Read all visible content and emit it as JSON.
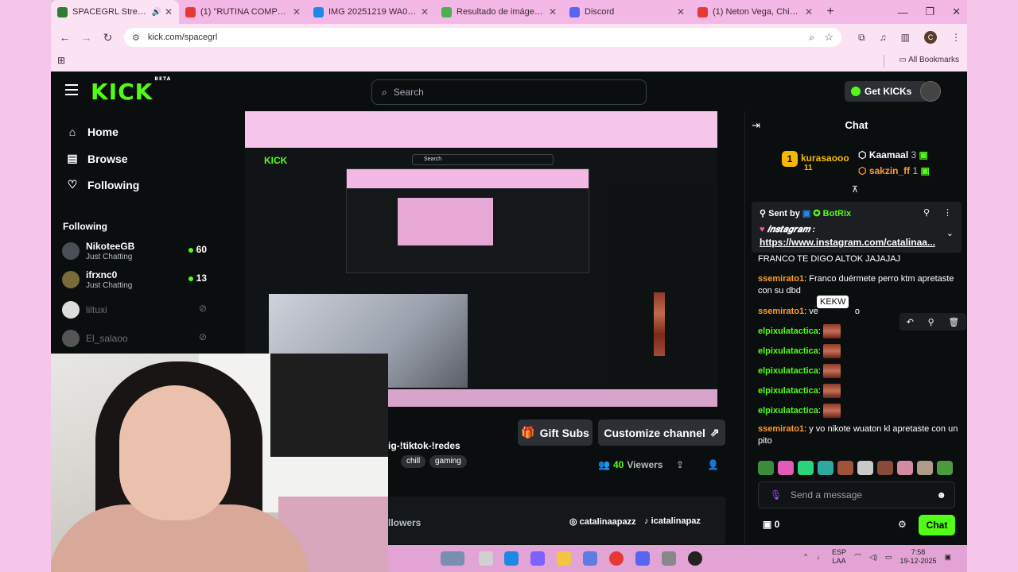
{
  "browser": {
    "tabs": [
      {
        "title": "SPACEGRL Stream - Watch",
        "color": "#2e7d32"
      },
      {
        "title": "(1) \"RUTINA COMPLETA\"",
        "color": "#e53935"
      },
      {
        "title": "IMG 20251219 WA0016 ho",
        "color": "#1e88e5"
      },
      {
        "title": "Resultado de imágenes de",
        "color": "#4caf50"
      },
      {
        "title": "Discord",
        "color": "#5865f2"
      },
      {
        "title": "(1) Neton Vega, Chino Pac",
        "color": "#e53935"
      }
    ],
    "new_tab": "+",
    "url": "kick.com/spacegrl",
    "bookmarks_label": "All Bookmarks",
    "profile_initial": "C"
  },
  "kick": {
    "logo": "KICK",
    "beta": "BETA",
    "search_placeholder": "Search",
    "get_kicks": "Get KICKs"
  },
  "sidebar": {
    "nav": [
      "Home",
      "Browse",
      "Following"
    ],
    "following_title": "Following",
    "following": [
      {
        "name": "NikoteeGB",
        "category": "Just Chatting",
        "viewers": "60",
        "live": true
      },
      {
        "name": "ifrxnc0",
        "category": "Just Chatting",
        "viewers": "13",
        "live": true
      },
      {
        "name": "liltuxi",
        "category": "",
        "viewers": "",
        "live": false
      },
      {
        "name": "El_salaoo",
        "category": "",
        "viewers": "",
        "live": false
      }
    ]
  },
  "stream": {
    "tagline": "ig-!tiktok-!redes",
    "tags": [
      "chill",
      "gaming"
    ],
    "gift_subs": "Gift Subs",
    "customize": "Customize channel",
    "viewers_count": "40",
    "viewers_label": "Viewers",
    "followers_label": "llowers",
    "instagram": "catalinaapazz",
    "tiktok": "icatalinapaz"
  },
  "chat": {
    "title": "Chat",
    "leaders": [
      {
        "name": "kurasaooo",
        "count": "11"
      },
      {
        "name": "Kaamaal",
        "count": "3"
      },
      {
        "name": "sakzin_ff",
        "count": "1"
      }
    ],
    "pinned": {
      "sent_by": "Sent by",
      "bot": "BotRix",
      "ig_label": "𝒊𝒏𝒔𝒕𝒂𝒈𝒓𝒂𝒎 :",
      "link": "https://www.instagram.com/catalinaa..."
    },
    "messages": [
      {
        "user": "",
        "text": "FRANCO TE DIGO ALTOK JAJAJAJ"
      },
      {
        "user": "ssemirato1",
        "text": "Franco duérmete perro ktm apretaste con su dbd"
      },
      {
        "user": "ssemirato1",
        "text": "ve"
      },
      {
        "user": "elpixulatactica",
        "text": ""
      },
      {
        "user": "elpixulatactica",
        "text": ""
      },
      {
        "user": "elpixulatactica",
        "text": ""
      },
      {
        "user": "elpixulatactica",
        "text": ""
      },
      {
        "user": "elpixulatactica",
        "text": ""
      },
      {
        "user": "ssemirato1",
        "text": "y vo nikote wuaton kl apretaste con un pito"
      }
    ],
    "partial_word": "o",
    "tooltip": "KEKW",
    "input_placeholder": "Send a message",
    "kicks_count": "0",
    "chat_button": "Chat"
  },
  "taskbar": {
    "lang_top": "ESP",
    "lang_bottom": "LAA",
    "time": "7:58",
    "date": "19-12-2025"
  }
}
